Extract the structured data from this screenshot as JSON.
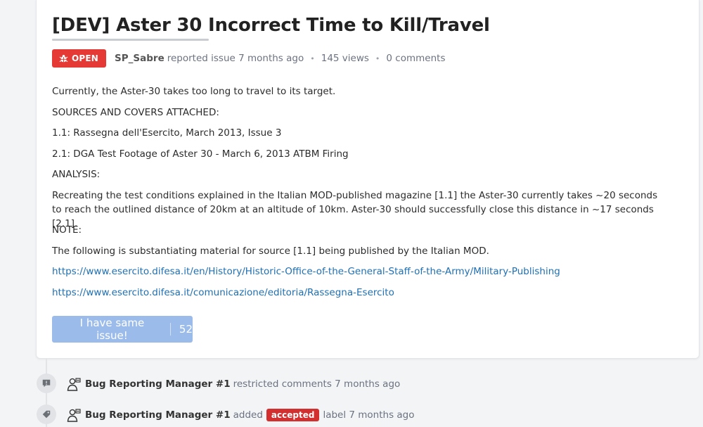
{
  "issue": {
    "title": "[DEV] Aster 30 Incorrect Time to Kill/Travel",
    "status": "OPEN",
    "author": "SP_Sabre",
    "action": "reported issue 7 months ago",
    "views": "145 views",
    "comments": "0 comments"
  },
  "body": {
    "paragraphs": [
      "Currently, the Aster-30 takes too long to travel to its target.",
      "SOURCES AND COVERS ATTACHED:",
      "1.1: Rassegna dell'Esercito, March 2013, Issue 3",
      "2.1: DGA Test Footage of Aster 30 - March 6, 2013 ATBM Firing",
      "ANALYSIS:",
      "Recreating the test conditions explained in the Italian MOD-published magazine [1.1] the Aster-30 currently takes ~20 seconds to reach the outlined distance of 20km at an altitude of 10km. Aster-30 should successfully close this distance in ~17 seconds [2.1].",
      "NOTE:",
      "The following is substantiating material for source [1.1] being published by the Italian MOD."
    ],
    "links": [
      "https://www.esercito.difesa.it/en/History/Historic-Office-of-the-General-Staff-of-the-Army/Military-Publishing",
      "https://www.esercito.difesa.it/comunicazione/editoria/Rassegna-Esercito"
    ]
  },
  "same_issue": {
    "label": "I have same issue!",
    "count": "52"
  },
  "timeline": [
    {
      "icon": "comment-restricted-icon",
      "user": "Bug Reporting Manager #1",
      "text": "restricted comments 7 months ago"
    },
    {
      "icon": "tag-icon",
      "user": "Bug Reporting Manager #1",
      "text_before": "added",
      "label": "accepted",
      "text_after": "label 7 months ago"
    }
  ],
  "colors": {
    "open_badge": "#e53935",
    "accepted_label": "#d32f2f",
    "link": "#1f6fb2",
    "same_issue_button": "#9bbcea"
  }
}
